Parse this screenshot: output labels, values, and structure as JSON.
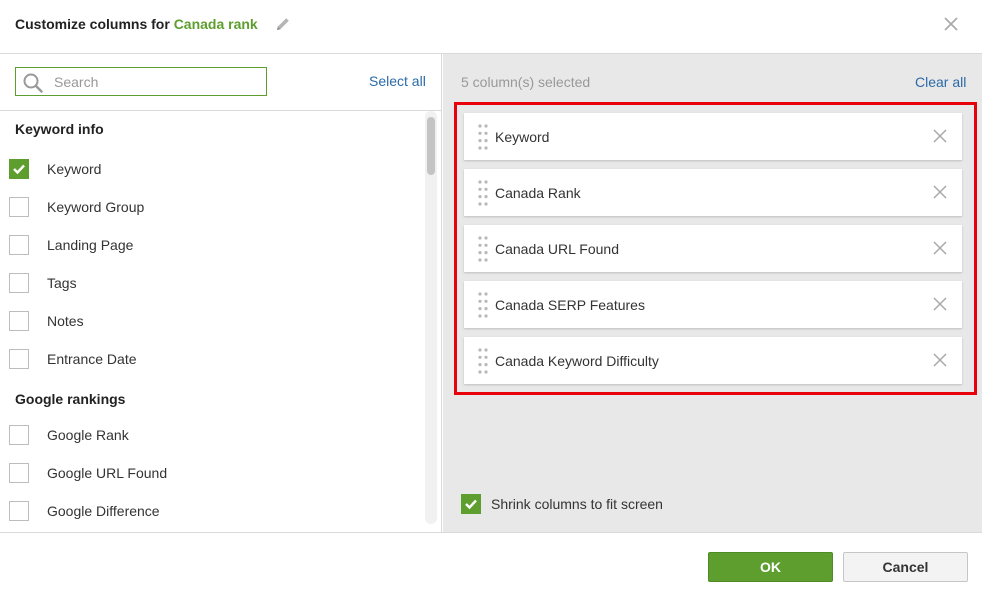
{
  "header": {
    "title_prefix": "Customize columns for ",
    "title_accent": "Canada rank"
  },
  "left_panel": {
    "search_placeholder": "Search",
    "select_all_label": "Select all",
    "groups": [
      {
        "title": "Keyword info",
        "items": [
          {
            "label": "Keyword",
            "checked": true
          },
          {
            "label": "Keyword Group",
            "checked": false
          },
          {
            "label": "Landing Page",
            "checked": false
          },
          {
            "label": "Tags",
            "checked": false
          },
          {
            "label": "Notes",
            "checked": false
          },
          {
            "label": "Entrance Date",
            "checked": false
          }
        ]
      },
      {
        "title": "Google rankings",
        "items": [
          {
            "label": "Google Rank",
            "checked": false
          },
          {
            "label": "Google URL Found",
            "checked": false
          },
          {
            "label": "Google Difference",
            "checked": false
          }
        ]
      }
    ]
  },
  "right_panel": {
    "selected_count_label": "5 column(s) selected",
    "clear_all_label": "Clear all",
    "selected_columns": [
      "Keyword",
      "Canada Rank",
      "Canada URL Found",
      "Canada SERP Features",
      "Canada Keyword Difficulty"
    ],
    "shrink_label": "Shrink columns to fit screen",
    "shrink_checked": true
  },
  "footer": {
    "ok_label": "OK",
    "cancel_label": "Cancel"
  },
  "colors": {
    "accent_green": "#5d9e2f",
    "link_blue": "#2b6aa8",
    "highlight_red": "#e8000b"
  },
  "icons": {
    "edit": "pencil-icon",
    "close": "close-icon",
    "search": "search-icon",
    "check": "check-icon",
    "drag": "drag-handle-icon",
    "remove": "remove-icon"
  }
}
